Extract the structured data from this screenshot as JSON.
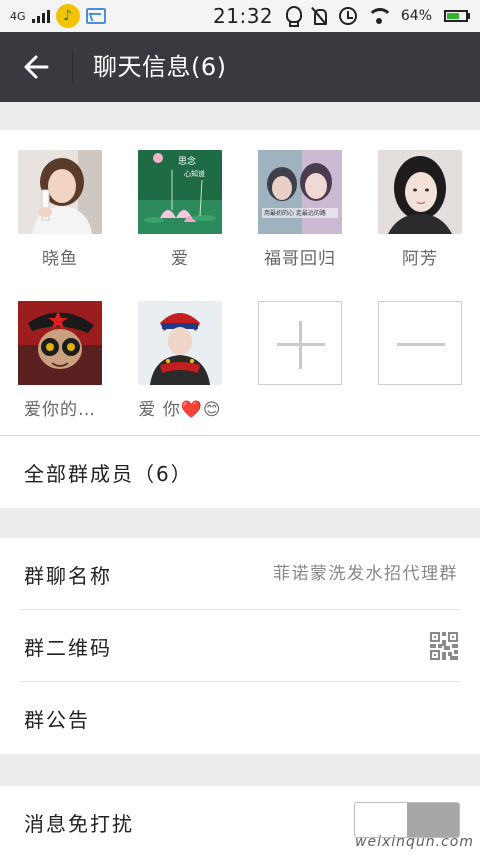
{
  "status_bar": {
    "network": "4G",
    "time": "21:32",
    "battery": "64%",
    "battery_level": 0.64
  },
  "header": {
    "title": "聊天信息(6)"
  },
  "members": [
    {
      "name": "晓鱼"
    },
    {
      "name": "爱"
    },
    {
      "name": "福哥回归"
    },
    {
      "name": "阿芳"
    },
    {
      "name": "爱你的…"
    },
    {
      "name": "爱 你❤️😊"
    }
  ],
  "avatar_texts": {
    "member_2_line1": "思念",
    "member_2_line2": "心知道",
    "member_3_overlay": "用最初的心 走最远的路"
  },
  "all_members": {
    "label": "全部群成员（6）"
  },
  "settings": {
    "group_name_label": "群聊名称",
    "group_name_value": "菲诺蒙洗发水招代理群",
    "qr_label": "群二维码",
    "notice_label": "群公告",
    "dnd_label": "消息免打扰",
    "dnd_on": false
  },
  "watermark": "weixinqun.com",
  "colors": {
    "title_bar": "#393a3f",
    "background": "#ececec",
    "battery": "#2fb52f"
  }
}
